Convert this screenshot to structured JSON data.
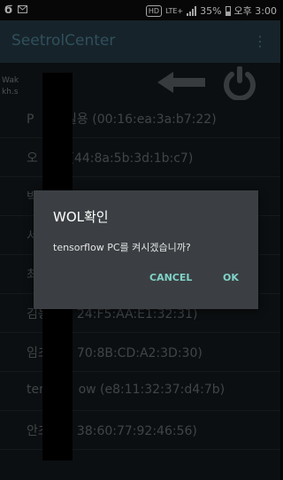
{
  "status_bar": {
    "left_icons": [
      "carrier-logo-icon",
      "mail-icon"
    ],
    "hd": "HD",
    "network": "LTE+",
    "battery": "35%",
    "time": "오후 3:00"
  },
  "app_bar": {
    "title": "SeetrolCenter",
    "menu_icon": "more-vert-icon"
  },
  "header": {
    "account_line1": "Wak          an -",
    "account_line2": "kh.s            .com",
    "back_icon": "arrow-left-icon",
    "power_icon": "power-icon"
  },
  "devices": [
    {
      "text": "P        실용 (00:16:ea:3a:b7:22)"
    },
    {
      "text": "오        (44:8a:5b:3d:1b:c7)"
    },
    {
      "text": "박"
    },
    {
      "text": "서"
    },
    {
      "text": "최"
    },
    {
      "text": "김동       24:F5:AA:E1:32:31)"
    },
    {
      "text": "임초       70:8B:CD:A2:3D:30)"
    },
    {
      "text": "ten        ow (e8:11:32:37:d4:7b)"
    },
    {
      "text": "안초       38:60:77:92:46:56)"
    }
  ],
  "dialog": {
    "title": "WOL확인",
    "message": "tensorflow PC를 켜시겠습니까?",
    "cancel_label": "CANCEL",
    "ok_label": "OK"
  },
  "colors": {
    "app_bar": "#1f2f38",
    "dialog_bg": "#3b3f43",
    "dialog_button": "#7fd3c7"
  }
}
